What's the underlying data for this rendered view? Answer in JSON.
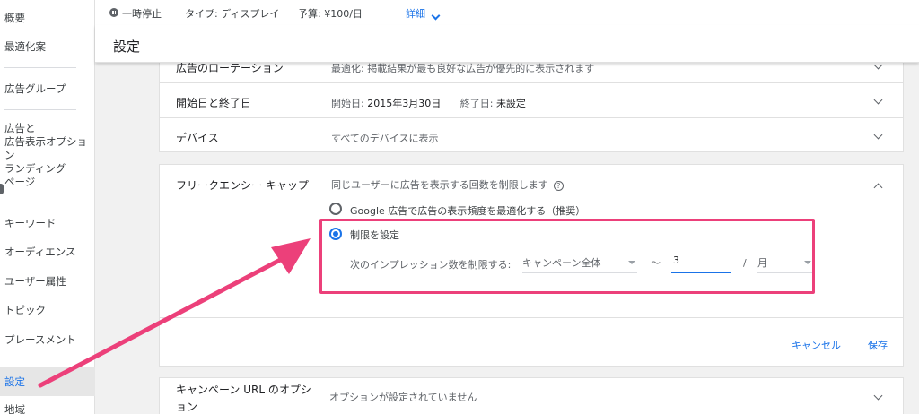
{
  "sidebar": {
    "items": [
      {
        "label": "概要"
      },
      {
        "label": "最適化案"
      },
      {
        "label": "広告グループ"
      },
      {
        "label": "広告と\n広告表示オプション"
      },
      {
        "label": "ランディング\nページ"
      },
      {
        "label": "キーワード"
      },
      {
        "label": "オーディエンス"
      },
      {
        "label": "ユーザー属性"
      },
      {
        "label": "トピック"
      },
      {
        "label": "プレースメント"
      },
      {
        "label": "設定"
      },
      {
        "label": "地域"
      }
    ]
  },
  "status": {
    "state": "一時停止",
    "type": "タイプ: ディスプレイ",
    "budget": "予算: ¥100/日",
    "details": "詳細"
  },
  "page_title": "設定",
  "rows": {
    "rotation": {
      "label": "広告のローテーション",
      "value": "最適化: 掲載結果が最も良好な広告が優先的に表示されます"
    },
    "dates": {
      "label": "開始日と終了日",
      "start_label": "開始日:",
      "start_value": "2015年3月30日",
      "end_label": "終了日:",
      "end_value": "未設定"
    },
    "device": {
      "label": "デバイス",
      "value": "すべてのデバイスに表示"
    }
  },
  "frequency": {
    "label": "フリークエンシー キャップ",
    "description": "同じユーザーに広告を表示する回数を制限します",
    "help": "?",
    "option_auto": "Google 広告で広告の表示頻度を最適化する（推奨）",
    "option_manual": "制限を設定",
    "limit_label": "次のインプレッション数を制限する:",
    "scope_value": "キャンペーン全体",
    "tilde": "〜",
    "count_value": "3",
    "slash": "/",
    "period_value": "月",
    "cancel": "キャンセル",
    "save": "保存"
  },
  "url_options": {
    "label": "キャンペーン URL のオプション",
    "value": "オプションが設定されていません"
  },
  "colors": {
    "accent": "#1a73e8",
    "annotation": "#ec407a"
  }
}
